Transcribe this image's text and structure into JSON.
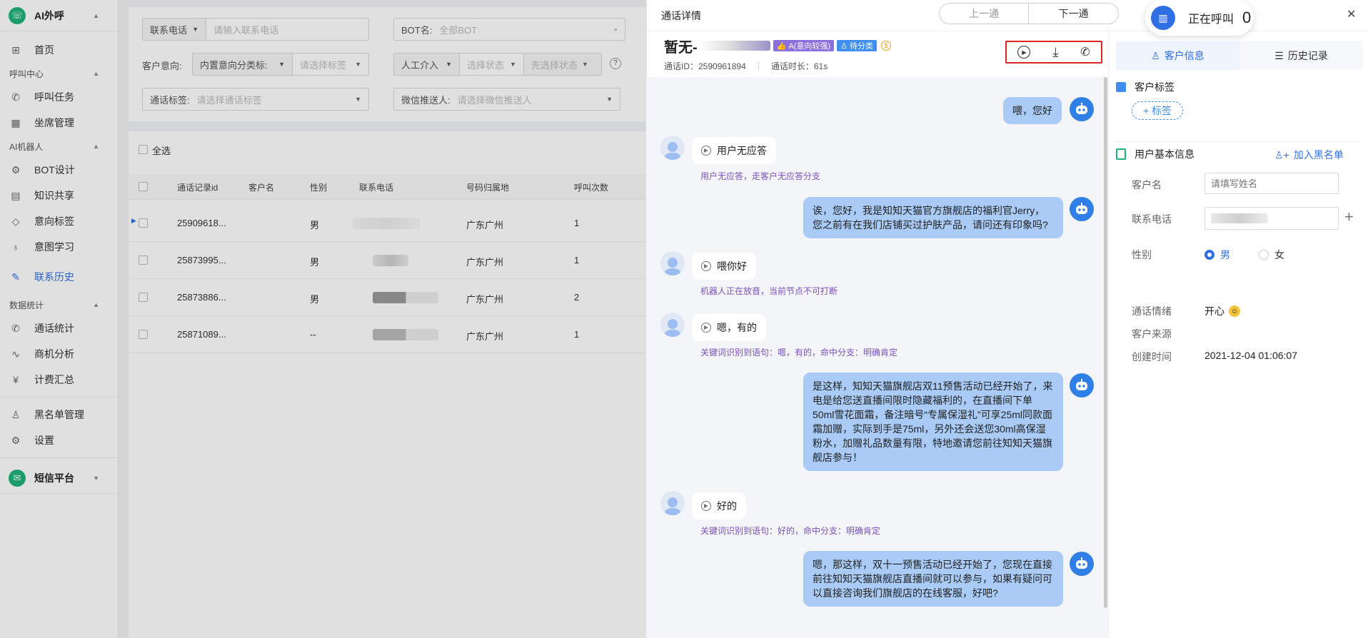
{
  "sidebar": {
    "brand": "AI外呼",
    "items": [
      {
        "label": "首页",
        "icon": "home-icon"
      },
      {
        "group": "呼叫中心"
      },
      {
        "label": "呼叫任务",
        "icon": "phone-task-icon"
      },
      {
        "label": "坐席管理",
        "icon": "grid-icon"
      },
      {
        "group": "AI机器人"
      },
      {
        "label": "BOT设计",
        "icon": "flow-icon"
      },
      {
        "label": "知识共享",
        "icon": "book-icon"
      },
      {
        "label": "意向标签",
        "icon": "tag-icon"
      },
      {
        "label": "意图学习",
        "icon": "bulb-icon"
      },
      {
        "label": "联系历史",
        "icon": "history-icon",
        "active": true
      },
      {
        "group": "数据统计"
      },
      {
        "label": "通话统计",
        "icon": "call-stat-icon"
      },
      {
        "label": "商机分析",
        "icon": "trend-icon"
      },
      {
        "label": "计费汇总",
        "icon": "bill-icon"
      },
      {
        "label": "黑名单管理",
        "icon": "blacklist-icon"
      },
      {
        "label": "设置",
        "icon": "settings-icon"
      }
    ],
    "sms": "短信平台"
  },
  "filters": {
    "phone_select": "联系电话",
    "phone_placeholder": "请输入联系电话",
    "bot_label": "BOT名:",
    "bot_value": "全部BOT",
    "intent_label": "客户意向:",
    "intent_select": "内置意向分类标:",
    "tag_placeholder": "请选择标签",
    "manual_select": "人工介入",
    "status_placeholder": "选择状态",
    "status2_placeholder": "先选择状态",
    "call_tag_label": "通话标签:",
    "call_tag_placeholder": "请选择通话标签",
    "wechat_label": "微信推送人:",
    "wechat_placeholder": "请选择微信推送人"
  },
  "table": {
    "select_all": "全选",
    "headers": [
      "通话记录id",
      "客户名",
      "性别",
      "联系电话",
      "号码归属地",
      "呼叫次数"
    ],
    "rows": [
      {
        "id": "25909618...",
        "name": "",
        "gender": "男",
        "location": "广东广州",
        "count": "1"
      },
      {
        "id": "25873995...",
        "name": "",
        "gender": "男",
        "location": "广东广州",
        "count": "1"
      },
      {
        "id": "25873886...",
        "name": "",
        "gender": "男",
        "location": "广东广州",
        "count": "2"
      },
      {
        "id": "25871089...",
        "name": "",
        "gender": "--",
        "location": "广东广州",
        "count": "1"
      }
    ]
  },
  "drawer": {
    "title": "通话详情",
    "prev": "上一通",
    "next": "下一通",
    "calling_label": "正在呼叫",
    "calling_count": "0",
    "customer_title": "暂无-",
    "tag_intent": "A(意向较强)",
    "tag_pending": "待分类",
    "call_id": "通话ID：2590961894",
    "duration": "通话时长：61s"
  },
  "chat": {
    "m1": "喂，您好",
    "u1": "用户无应答",
    "n1": "用户无应答，走客户无应答分支",
    "m2": "诶，您好，我是知知天猫官方旗舰店的福利官Jerry，您之前有在我们店铺买过护肤产品，请问还有印象吗?",
    "u2": "喂你好",
    "n2": "机器人正在放音，当前节点不可打断",
    "u3": "嗯，有的",
    "n3": "关键词识别到语句：嗯，有的，命中分支：明确肯定",
    "m3": "是这样，知知天猫旗舰店双11预售活动已经开始了，来电是给您送直播间限时隐藏福利的，在直播间下单50ml雪花面霜，备注暗号“专属保湿礼”可享25ml同款面霜加赠，实际到手是75ml，另外还会送您30ml高保湿粉水，加赠礼品数量有限，特地邀请您前往知知天猫旗舰店参与！",
    "u4": "好的",
    "n4": "关键词识别到语句：好的，命中分支：明确肯定",
    "m4": "嗯，那这样，双十一预售活动已经开始了，您现在直接前往知知天猫旗舰店直播间就可以参与，如果有疑问可以直接咨询我们旗舰店的在线客服，好吧?"
  },
  "panel": {
    "tab_info": "客户信息",
    "tab_history": "历史记录",
    "tags_title": "客户标签",
    "add_tag": "+ 标签",
    "basic_title": "用户基本信息",
    "blacklist": "加入黑名单",
    "name_label": "客户名",
    "name_placeholder": "请填写姓名",
    "phone_label": "联系电话",
    "gender_label": "性别",
    "male": "男",
    "female": "女",
    "mood_label": "通话情绪",
    "mood_value": "开心",
    "source_label": "客户来源",
    "created_label": "创建时间",
    "created_value": "2021-12-04 01:06:07"
  }
}
